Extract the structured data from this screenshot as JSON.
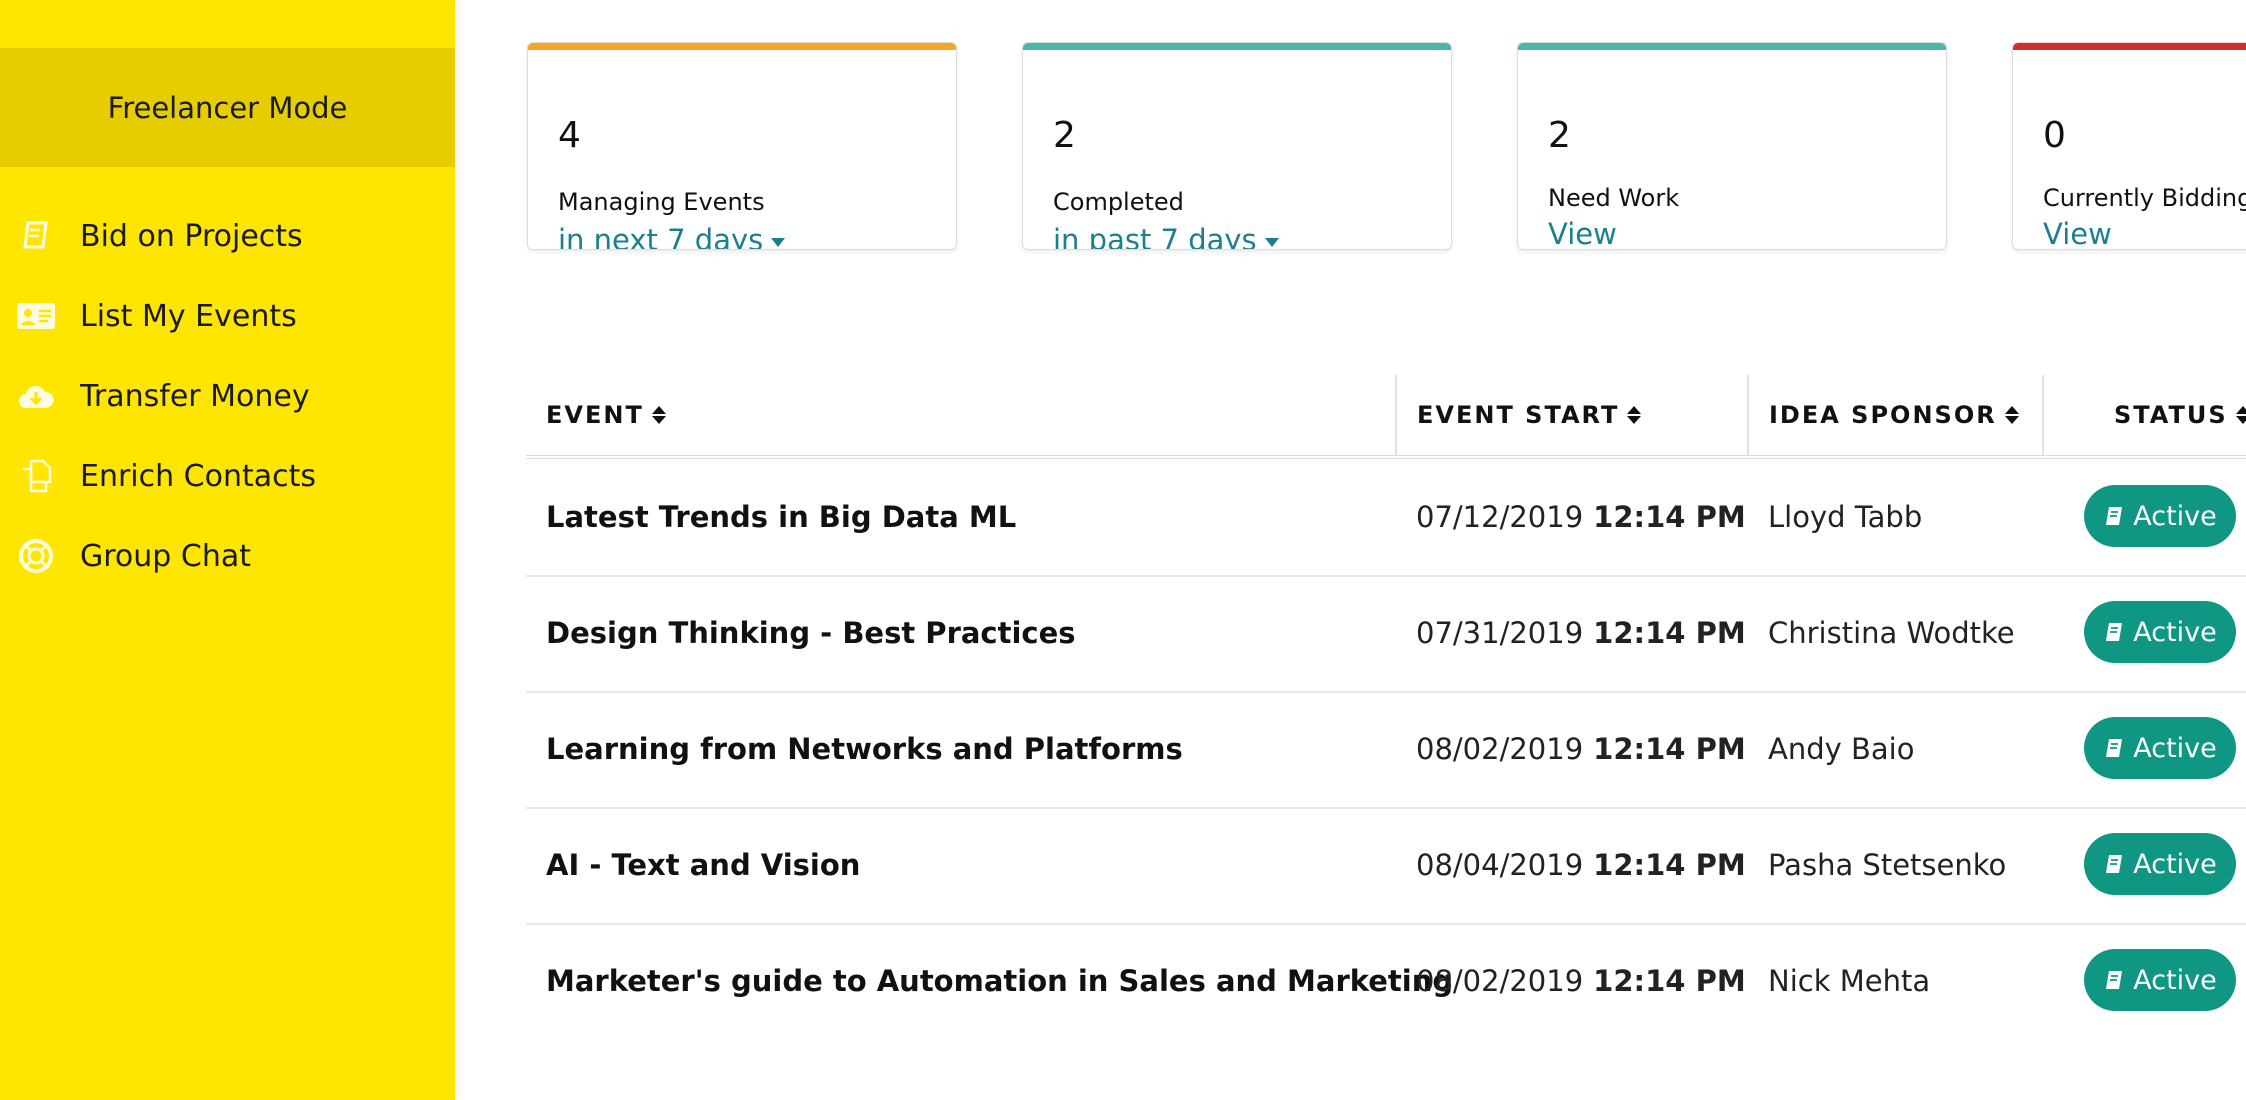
{
  "sidebar": {
    "mode": "Freelancer Mode",
    "items": [
      {
        "label": "Bid on Projects",
        "icon": "book-icon"
      },
      {
        "label": "List My Events",
        "icon": "id-card-icon"
      },
      {
        "label": "Transfer Money",
        "icon": "cloud-download-icon"
      },
      {
        "label": "Enrich Contacts",
        "icon": "copy-icon"
      },
      {
        "label": "Group Chat",
        "icon": "life-ring-icon"
      }
    ]
  },
  "cards": [
    {
      "count": "4",
      "title": "Managing Events",
      "link": "in next 7 days",
      "accent": "#f5a623"
    },
    {
      "count": "2",
      "title": "Completed",
      "link": "in past 7 days",
      "accent": "#4db6ac"
    },
    {
      "count": "2",
      "title": "Need Work",
      "link": "View",
      "accent": "#4db6ac"
    },
    {
      "count": "0",
      "title": "Currently Bidding",
      "link": "View",
      "accent": "#d32f2f"
    }
  ],
  "table": {
    "headers": [
      "EVENT",
      "EVENT START",
      "IDEA SPONSOR",
      "STATUS"
    ],
    "rows": [
      {
        "event": "Latest Trends in Big Data ML",
        "date": "07/12/2019",
        "time": "12:14 PM",
        "sponsor": "Lloyd Tabb",
        "status": "Active"
      },
      {
        "event": "Design Thinking - Best Practices",
        "date": "07/31/2019",
        "time": "12:14 PM",
        "sponsor": "Christina Wodtke",
        "status": "Active"
      },
      {
        "event": "Learning from Networks and Platforms",
        "date": "08/02/2019",
        "time": "12:14 PM",
        "sponsor": "Andy Baio",
        "status": "Active"
      },
      {
        "event": "AI - Text and Vision",
        "date": "08/04/2019",
        "time": "12:14 PM",
        "sponsor": "Pasha Stetsenko",
        "status": "Active"
      },
      {
        "event": "Marketer's guide to Automation in Sales and Marketing",
        "date": "08/02/2019",
        "time": "12:14 PM",
        "sponsor": "Nick Mehta",
        "status": "Active"
      }
    ]
  },
  "colors": {
    "sidebar": "#ffe600",
    "sidebar_banner": "#e5cd00",
    "link": "#1a7f8e",
    "status": "#0f9784"
  }
}
